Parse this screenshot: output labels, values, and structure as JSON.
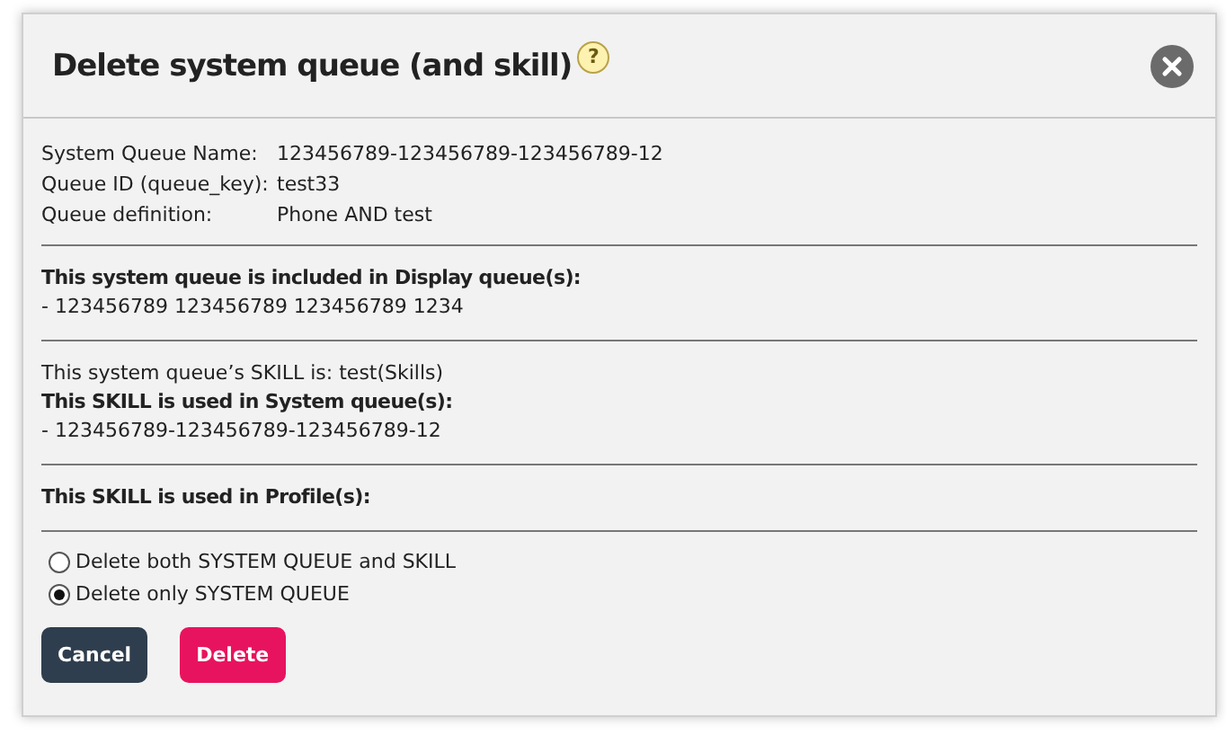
{
  "dialog": {
    "title": "Delete system queue (and skill)",
    "help_icon": "?"
  },
  "details": [
    {
      "label": "System Queue Name:",
      "value": "123456789-123456789-123456789-12"
    },
    {
      "label": "Queue ID (queue_key):",
      "value": "test33"
    },
    {
      "label": "Queue definition:",
      "value": "Phone AND test"
    }
  ],
  "sections": [
    {
      "lines": [
        {
          "text": "This system queue is included in Display queue(s):",
          "bold": true
        },
        {
          "text": "- 123456789 123456789 123456789 1234",
          "bold": false
        }
      ]
    },
    {
      "lines": [
        {
          "text": "This system queue’s SKILL is: test(Skills)",
          "bold": false
        },
        {
          "text": "This SKILL is used in System queue(s):",
          "bold": true
        },
        {
          "text": "- 123456789-123456789-123456789-12",
          "bold": false
        }
      ]
    },
    {
      "lines": [
        {
          "text": "This SKILL is used in Profile(s):",
          "bold": true
        }
      ]
    }
  ],
  "options": [
    {
      "label": "Delete both SYSTEM QUEUE and SKILL",
      "selected": false
    },
    {
      "label": "Delete only SYSTEM QUEUE",
      "selected": true
    }
  ],
  "buttons": [
    {
      "label": "Cancel",
      "kind": "secondary"
    },
    {
      "label": "Delete",
      "kind": "danger"
    }
  ]
}
